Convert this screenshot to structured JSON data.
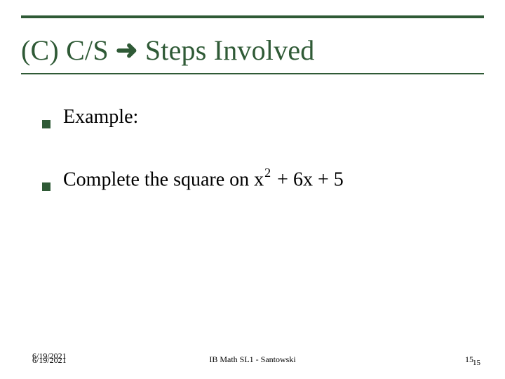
{
  "title": {
    "prefix": "(C) C/S",
    "arrow": "➜",
    "rest": "Steps Involved"
  },
  "bullets": [
    {
      "text_plain": "Example:"
    },
    {
      "text_prefix": "Complete the square on x",
      "exp": "2",
      "text_suffix": " + 6x + 5"
    }
  ],
  "footer": {
    "date": "6/19/2021",
    "center": "IB Math SL1 - Santowski",
    "page_main": "15",
    "page_sub": "15"
  }
}
